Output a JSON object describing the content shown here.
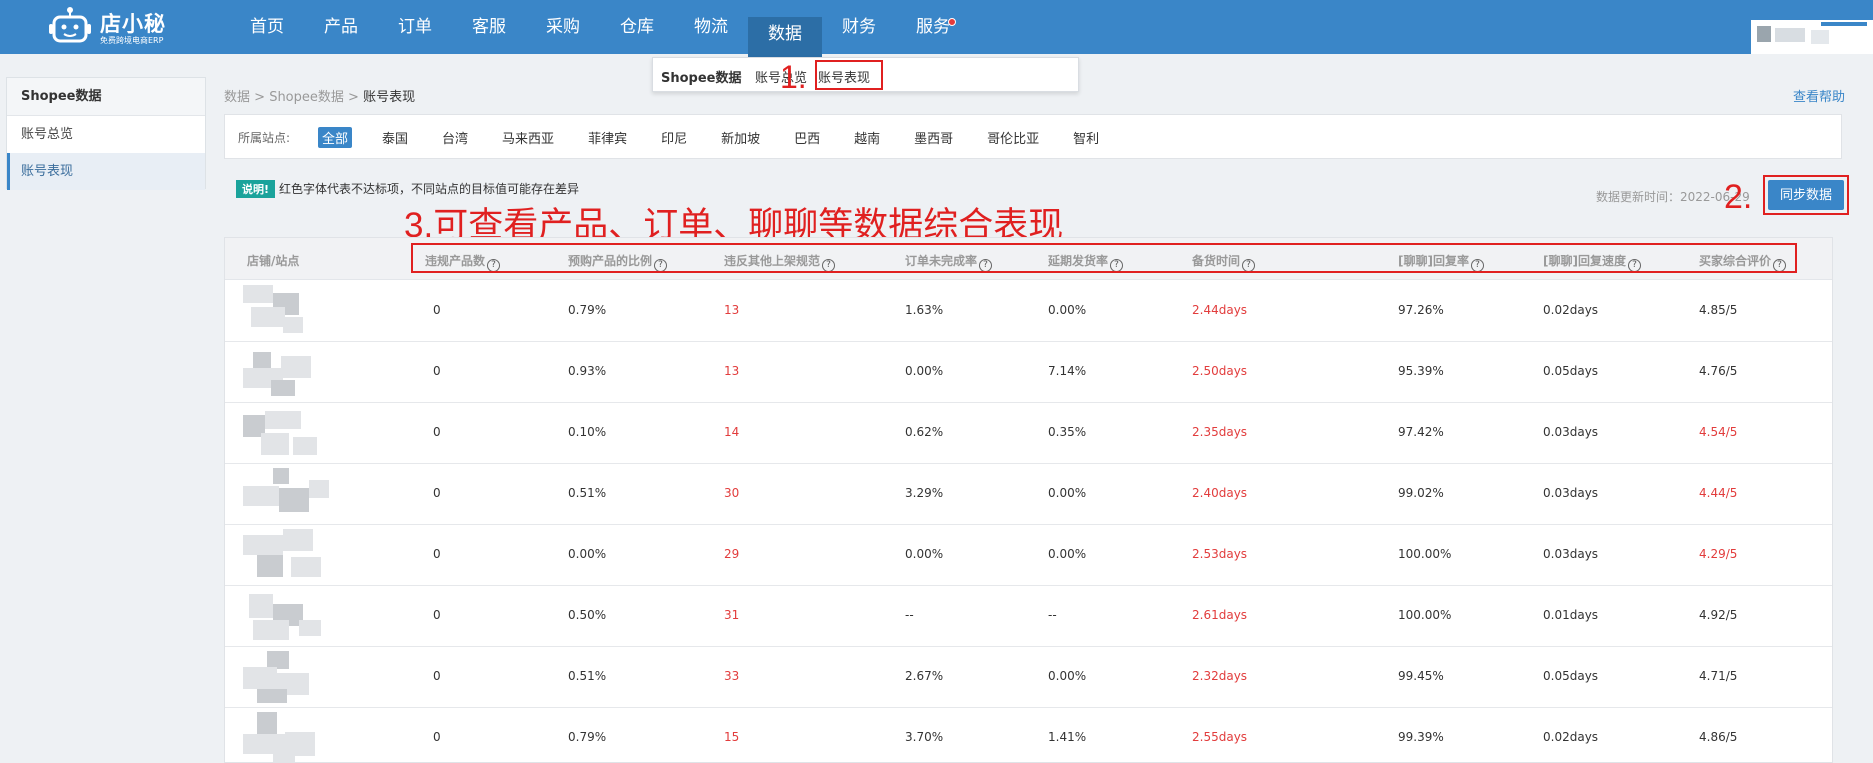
{
  "logo": {
    "name": "店小秘",
    "sub": "免费跨境电商ERP"
  },
  "nav": [
    {
      "label": "首页",
      "active": false
    },
    {
      "label": "产品",
      "active": false
    },
    {
      "label": "订单",
      "active": false
    },
    {
      "label": "客服",
      "active": false
    },
    {
      "label": "采购",
      "active": false
    },
    {
      "label": "仓库",
      "active": false
    },
    {
      "label": "物流",
      "active": false
    },
    {
      "label": "数据",
      "active": true
    },
    {
      "label": "财务",
      "active": false
    },
    {
      "label": "服务",
      "active": false,
      "dot": true
    }
  ],
  "subnav": {
    "title": "Shopee数据",
    "link1": "账号总览",
    "link2": "账号表现"
  },
  "annotations": {
    "a1": "1.",
    "a2": "2.",
    "a3": "3.可查看产品、订单、聊聊等数据综合表现"
  },
  "sidebar": {
    "title": "Shopee数据",
    "items": [
      {
        "label": "账号总览"
      },
      {
        "label": "账号表现"
      }
    ]
  },
  "breadcrumb": {
    "p1": "数据",
    "sep": " > ",
    "p2": "Shopee数据",
    "p3": "账号表现"
  },
  "help": "查看帮助",
  "station": {
    "label": "所属站点:",
    "options": [
      "全部",
      "泰国",
      "台湾",
      "马来西亚",
      "菲律宾",
      "印尼",
      "新加坡",
      "巴西",
      "越南",
      "墨西哥",
      "哥伦比亚",
      "智利"
    ]
  },
  "note": {
    "badge": "说明!",
    "text": "红色字体代表不达标项，不同站点的目标值可能存在差异"
  },
  "update_time": "数据更新时间：2022-06-29",
  "sync_button": "同步数据",
  "table": {
    "headers": [
      "店铺/站点",
      "违规产品数",
      "预购产品的比例",
      "违反其他上架规范",
      "订单未完成率",
      "延期发货率",
      "备货时间",
      "[聊聊]回复率",
      "[聊聊]回复速度",
      "买家综合评价"
    ],
    "rows": [
      {
        "c1": "0",
        "c2": "0.79%",
        "c3": "13",
        "c4": "1.63%",
        "c5": "0.00%",
        "c6": "2.44days",
        "c7": "97.26%",
        "c8": "0.02days",
        "c9": "4.85/5",
        "red9": false
      },
      {
        "c1": "0",
        "c2": "0.93%",
        "c3": "13",
        "c4": "0.00%",
        "c5": "7.14%",
        "c6": "2.50days",
        "c7": "95.39%",
        "c8": "0.05days",
        "c9": "4.76/5",
        "red9": false
      },
      {
        "c1": "0",
        "c2": "0.10%",
        "c3": "14",
        "c4": "0.62%",
        "c5": "0.35%",
        "c6": "2.35days",
        "c7": "97.42%",
        "c8": "0.03days",
        "c9": "4.54/5",
        "red9": true
      },
      {
        "c1": "0",
        "c2": "0.51%",
        "c3": "30",
        "c4": "3.29%",
        "c5": "0.00%",
        "c6": "2.40days",
        "c7": "99.02%",
        "c8": "0.03days",
        "c9": "4.44/5",
        "red9": true
      },
      {
        "c1": "0",
        "c2": "0.00%",
        "c3": "29",
        "c4": "0.00%",
        "c5": "0.00%",
        "c6": "2.53days",
        "c7": "100.00%",
        "c8": "0.03days",
        "c9": "4.29/5",
        "red9": true
      },
      {
        "c1": "0",
        "c2": "0.50%",
        "c3": "31",
        "c4": "--",
        "c5": "--",
        "c6": "2.61days",
        "c7": "100.00%",
        "c8": "0.01days",
        "c9": "4.92/5",
        "red9": false
      },
      {
        "c1": "0",
        "c2": "0.51%",
        "c3": "33",
        "c4": "2.67%",
        "c5": "0.00%",
        "c6": "2.32days",
        "c7": "99.45%",
        "c8": "0.05days",
        "c9": "4.71/5",
        "red9": false
      },
      {
        "c1": "0",
        "c2": "0.79%",
        "c3": "15",
        "c4": "3.70%",
        "c5": "1.41%",
        "c6": "2.55days",
        "c7": "99.39%",
        "c8": "0.02days",
        "c9": "4.86/5",
        "red9": false
      }
    ]
  },
  "colors": {
    "brand": "#3a86c8",
    "warn": "#e23c3c",
    "annotation": "#e02020"
  }
}
